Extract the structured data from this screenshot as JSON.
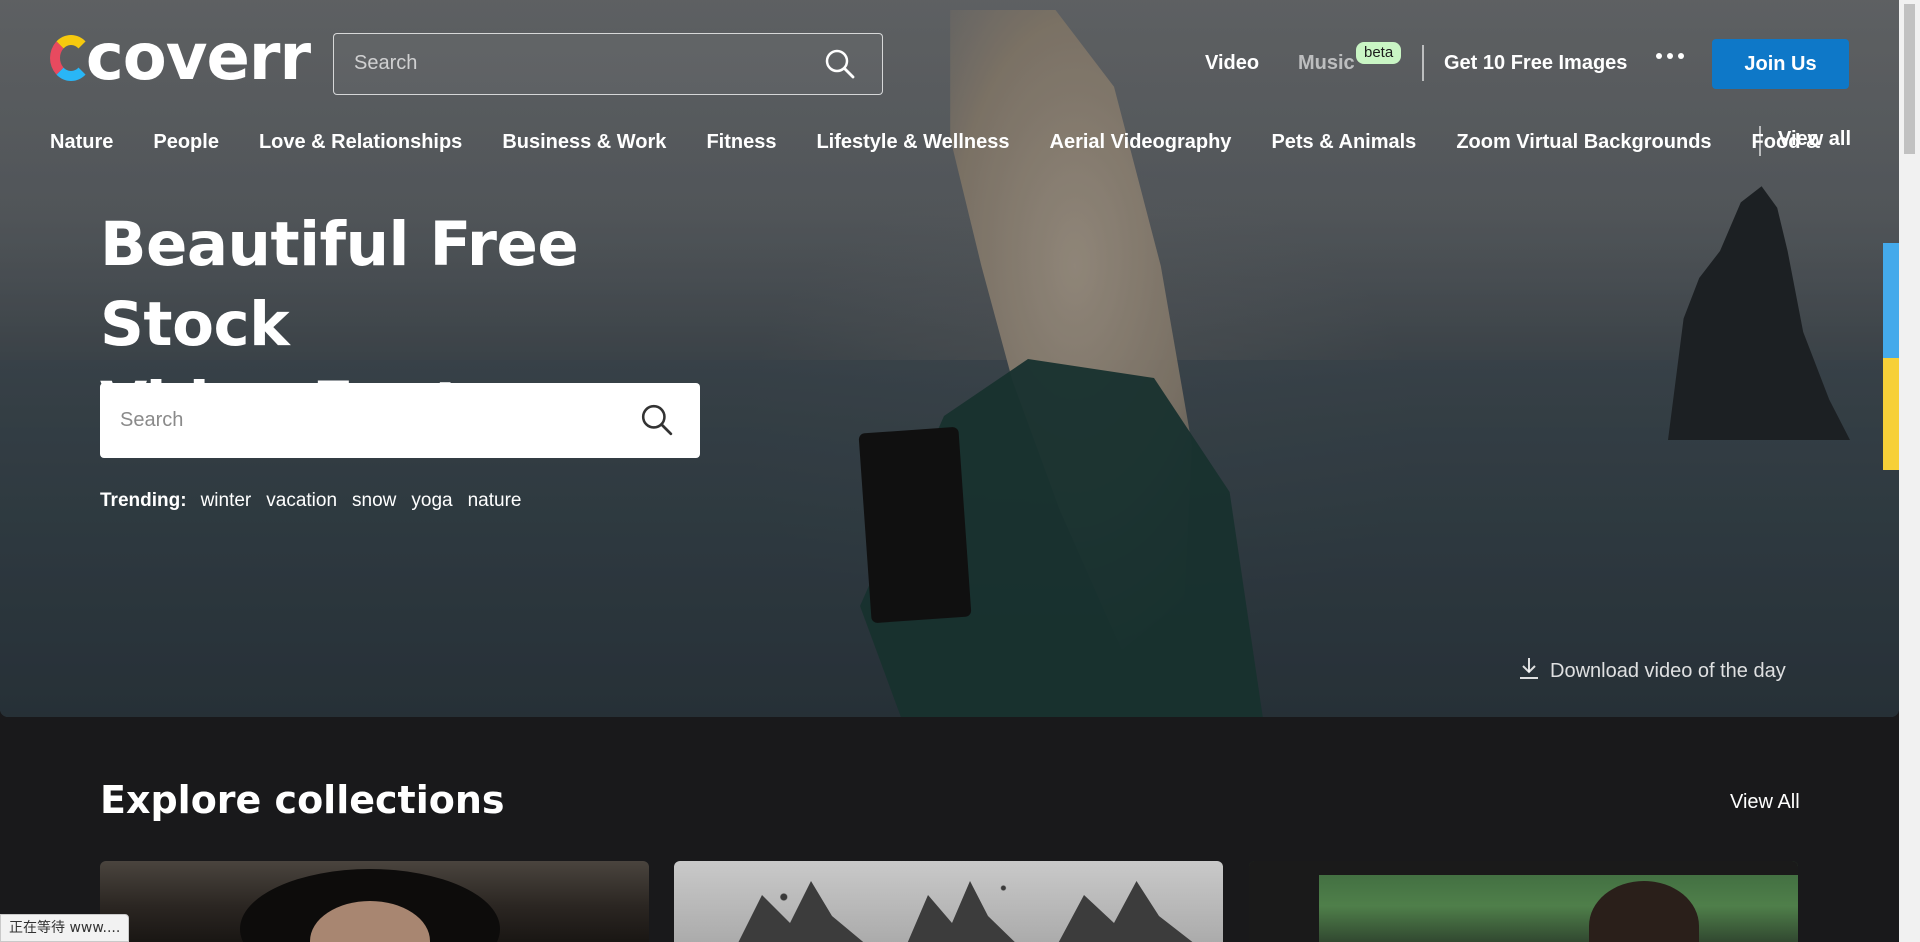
{
  "header": {
    "logo_text": "coverr",
    "search_placeholder": "Search",
    "nav": {
      "video": "Video",
      "music": "Music",
      "music_badge": "beta",
      "free_images": "Get 10 Free Images",
      "join": "Join Us"
    }
  },
  "categories": {
    "items": [
      "Nature",
      "People",
      "Love & Relationships",
      "Business & Work",
      "Fitness",
      "Lifestyle & Wellness",
      "Aerial Videography",
      "Pets & Animals",
      "Zoom Virtual Backgrounds",
      "Food &"
    ],
    "view_all": "View all"
  },
  "hero": {
    "title_line1": "Beautiful Free Stock",
    "title_line2": "Video Footage",
    "search_placeholder": "Search",
    "trending_label": "Trending:",
    "trending_tags": [
      "winter",
      "vacation",
      "snow",
      "yoga",
      "nature"
    ],
    "download_label": "Download video of the day"
  },
  "collections": {
    "title": "Explore collections",
    "view_all": "View All"
  },
  "status_bar": {
    "text": "正在等待 www...."
  },
  "colors": {
    "accent_blue": "#0e78c8",
    "beta_badge": "#c9f5c4",
    "page_background": "#19191b"
  },
  "icons": {
    "search": "search-icon",
    "more": "more-dots-icon",
    "download": "download-icon"
  }
}
